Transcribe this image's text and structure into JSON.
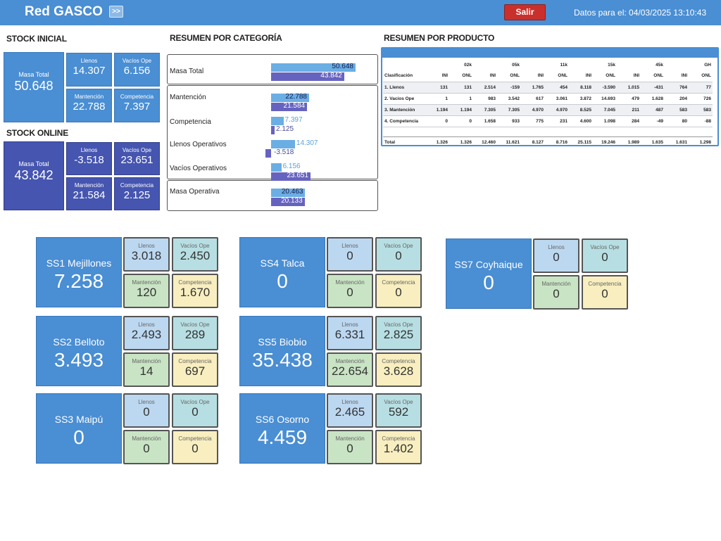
{
  "header": {
    "title": "Red GASCO",
    "expand_label": ">>",
    "exit_label": "Salir",
    "datos_label": "Datos para el: 04/03/2025 13:10:43"
  },
  "stock_inicial": {
    "title": "STOCK INICIAL",
    "masa_total": {
      "label": "Masa Total",
      "value": "50.648"
    },
    "llenos": {
      "label": "Llenos",
      "value": "14.307"
    },
    "vacios_ope": {
      "label": "Vacíos Ope",
      "value": "6.156"
    },
    "mantencion": {
      "label": "Mantención",
      "value": "22.788"
    },
    "competencia": {
      "label": "Competencia",
      "value": "7.397"
    }
  },
  "stock_online": {
    "title": "STOCK ONLINE",
    "masa_total": {
      "label": "Masa Total",
      "value": "43.842"
    },
    "llenos": {
      "label": "Llenos",
      "value": "-3.518"
    },
    "vacios_ope": {
      "label": "Vacíos Ope",
      "value": "23.651"
    },
    "mantencion": {
      "label": "Mantención",
      "value": "21.584"
    },
    "competencia": {
      "label": "Competencia",
      "value": "2.125"
    }
  },
  "resumen_categoria": {
    "title": "RESUMEN POR CATEGORÍA",
    "rows": [
      {
        "label": "Masa Total",
        "ini": "50.648",
        "onl": "43.842",
        "ini_n": 50648,
        "onl_n": 43842
      },
      {
        "label": "Mantención",
        "ini": "22.788",
        "onl": "21.584",
        "ini_n": 22788,
        "onl_n": 21584
      },
      {
        "label": "Competencia",
        "ini": "7.397",
        "onl": "2.125",
        "ini_n": 7397,
        "onl_n": 2125
      },
      {
        "label": "Llenos Operativos",
        "ini": "14.307",
        "onl": "-3.518",
        "ini_n": 14307,
        "onl_n": -3518
      },
      {
        "label": "Vacíos Operativos",
        "ini": "6.156",
        "onl": "23.651",
        "ini_n": 6156,
        "onl_n": 23651
      },
      {
        "label": "Masa Operativa",
        "ini": "20.463",
        "onl": "20.133",
        "ini_n": 20463,
        "onl_n": 20133
      }
    ]
  },
  "resumen_producto": {
    "title": "RESUMEN POR PRODUCTO",
    "products": [
      "02k",
      "05k",
      "11k",
      "15k",
      "45k",
      "GH"
    ],
    "first_header": "Clasificación",
    "subheaders": [
      "INI",
      "ONL"
    ],
    "rows": [
      {
        "label": "1. Llenos",
        "values": [
          "131",
          "131",
          "2.514",
          "-159",
          "1.765",
          "454",
          "8.118",
          "-3.590",
          "1.015",
          "-431",
          "764",
          "77"
        ]
      },
      {
        "label": "2. Vacíos Ope",
        "values": [
          "1",
          "1",
          "983",
          "3.542",
          "617",
          "3.061",
          "3.872",
          "14.693",
          "479",
          "1.628",
          "204",
          "726"
        ]
      },
      {
        "label": "3. Mantención",
        "values": [
          "1.194",
          "1.194",
          "7.305",
          "7.305",
          "4.970",
          "4.970",
          "8.525",
          "7.045",
          "211",
          "487",
          "583",
          "583"
        ]
      },
      {
        "label": "4. Competencia",
        "values": [
          "0",
          "0",
          "1.658",
          "933",
          "775",
          "231",
          "4.600",
          "1.098",
          "284",
          "-49",
          "80",
          "-88"
        ]
      }
    ],
    "total": {
      "label": "Total",
      "values": [
        "1.326",
        "1.326",
        "12.460",
        "11.621",
        "8.127",
        "8.716",
        "25.115",
        "19.246",
        "1.989",
        "1.635",
        "1.631",
        "1.298"
      ]
    }
  },
  "sub_labels": {
    "llenos": "Llenos",
    "vacios": "Vacíos Ope",
    "mantencion": "Mantención",
    "competencia": "Competencia"
  },
  "stations": {
    "ss1": {
      "name": "SS1 Mejillones",
      "total": "7.258",
      "llenos": "3.018",
      "vacios": "2.450",
      "mantencion": "120",
      "competencia": "1.670"
    },
    "ss2": {
      "name": "SS2 Belloto",
      "total": "3.493",
      "llenos": "2.493",
      "vacios": "289",
      "mantencion": "14",
      "competencia": "697"
    },
    "ss3": {
      "name": "SS3 Maipú",
      "total": "0",
      "llenos": "0",
      "vacios": "0",
      "mantencion": "0",
      "competencia": "0"
    },
    "ss4": {
      "name": "SS4 Talca",
      "total": "0",
      "llenos": "0",
      "vacios": "0",
      "mantencion": "0",
      "competencia": "0"
    },
    "ss5": {
      "name": "SS5 Biobio",
      "total": "35.438",
      "llenos": "6.331",
      "vacios": "2.825",
      "mantencion": "22.654",
      "competencia": "3.628"
    },
    "ss6": {
      "name": "SS6 Osorno",
      "total": "4.459",
      "llenos": "2.465",
      "vacios": "592",
      "mantencion": "0",
      "competencia": "1.402"
    },
    "ss7": {
      "name": "SS7 Coyhaique",
      "total": "0",
      "llenos": "0",
      "vacios": "0",
      "mantencion": "0",
      "competencia": "0"
    }
  },
  "colors": {
    "header": "#4a8ed3",
    "stock_inicial": "#4a8ed3",
    "stock_online": "#4555b0",
    "bar_ini": "#6aaee4",
    "bar_onl": "#6663c0",
    "exit_button": "#c9302c",
    "llenos": "#bcd8f1",
    "vacios": "#b7dfe3",
    "mantencion": "#c9e4c4",
    "competencia": "#f8eebf"
  }
}
